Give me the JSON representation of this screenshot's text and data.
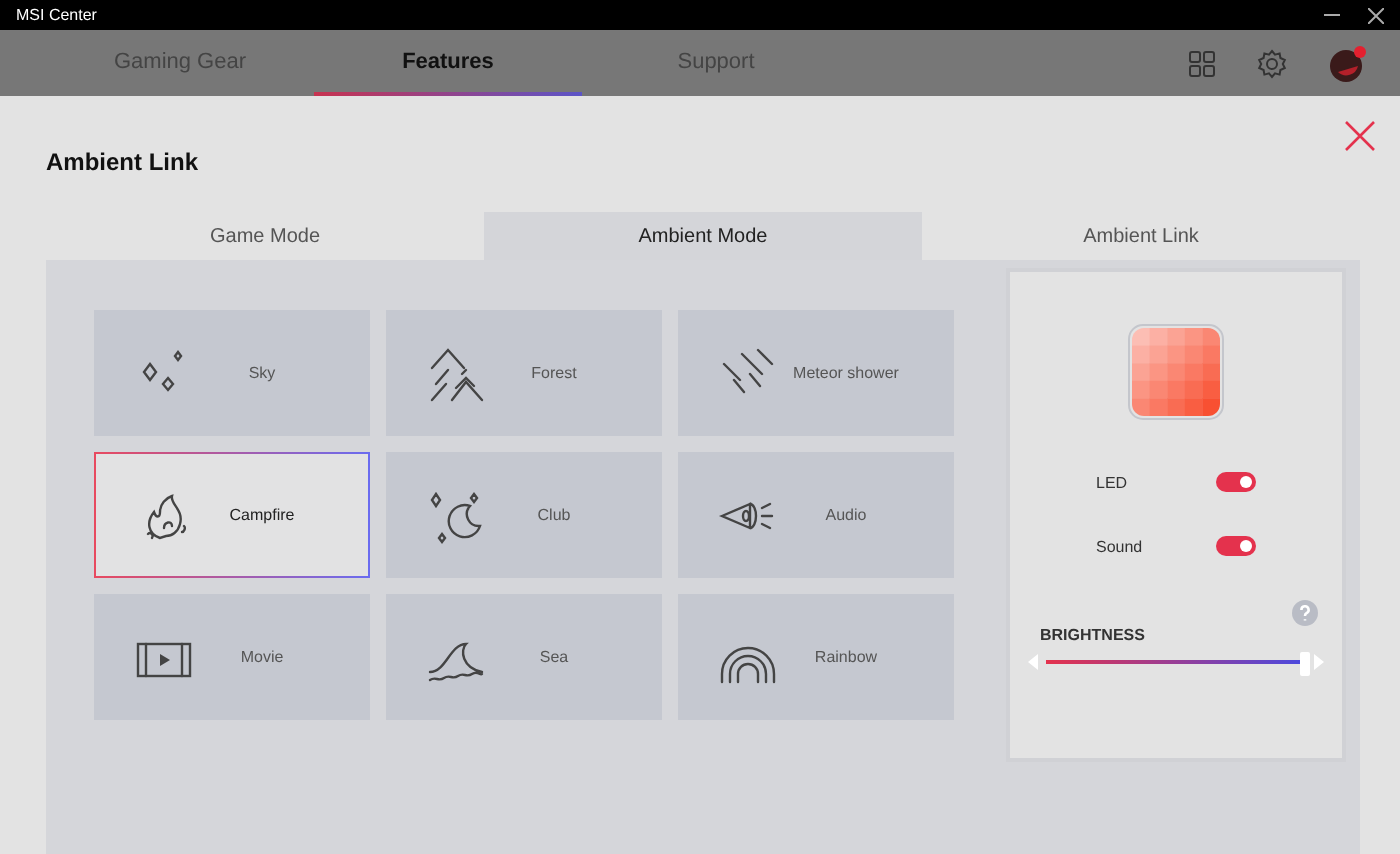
{
  "window": {
    "title": "MSI Center"
  },
  "nav_tabs": [
    {
      "label": "Gaming Gear",
      "selected": false
    },
    {
      "label": "Features",
      "selected": true
    },
    {
      "label": "Support",
      "selected": false
    }
  ],
  "dialog": {
    "title": "Ambient Link"
  },
  "mode_tabs": [
    {
      "label": "Game Mode",
      "selected": false
    },
    {
      "label": "Ambient Mode",
      "selected": true
    },
    {
      "label": "Ambient Link",
      "selected": false
    }
  ],
  "modes": [
    {
      "label": "Sky",
      "selected": false
    },
    {
      "label": "Forest",
      "selected": false
    },
    {
      "label": "Meteor shower",
      "selected": false
    },
    {
      "label": "Campfire",
      "selected": true
    },
    {
      "label": "Club",
      "selected": false
    },
    {
      "label": "Audio",
      "selected": false
    },
    {
      "label": "Movie",
      "selected": false
    },
    {
      "label": "Sea",
      "selected": false
    },
    {
      "label": "Rainbow",
      "selected": false
    }
  ],
  "toggles": [
    {
      "label": "LED",
      "on": true
    },
    {
      "label": "Sound",
      "on": true
    }
  ],
  "brightness": {
    "label": "BRIGHTNESS",
    "level": 1
  }
}
